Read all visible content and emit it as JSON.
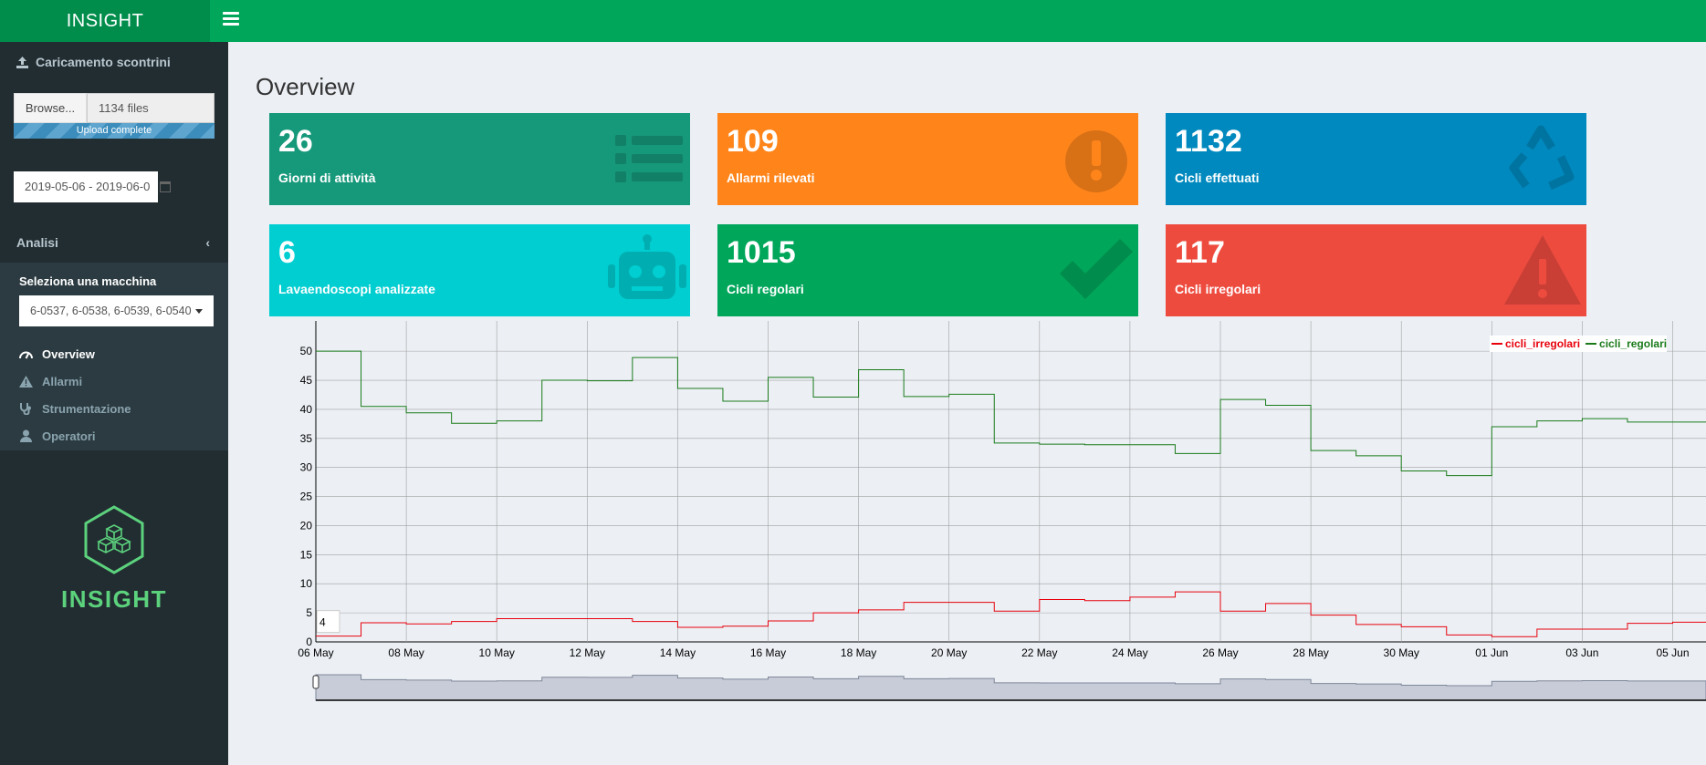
{
  "header": {
    "app_title": "INSIGHT",
    "menu_icon": "bars-icon"
  },
  "sidebar": {
    "upload_title": "Caricamento scontrini",
    "browse_label": "Browse...",
    "file_value": "1134 files",
    "progress_text": "Upload complete",
    "progress": 1.0,
    "date_range": "2019-05-06 - 2019-06-0",
    "section_label": "Analisi",
    "machine_label": "Seleziona una macchina",
    "machine_value": "6-0537, 6-0538, 6-0539, 6-0540",
    "nav": [
      {
        "label": "Overview",
        "icon": "tachometer-icon",
        "active": true
      },
      {
        "label": "Allarmi",
        "icon": "warning-icon",
        "active": false
      },
      {
        "label": "Strumentazione",
        "icon": "stethoscope-icon",
        "active": false
      },
      {
        "label": "Operatori",
        "icon": "user-icon",
        "active": false
      }
    ],
    "brand_name": "INSIGHT"
  },
  "main": {
    "title": "Overview",
    "boxes": [
      {
        "value": "26",
        "label": "Giorni di attività",
        "color": "#16987a",
        "icon": "list-icon"
      },
      {
        "value": "109",
        "label": "Allarmi rilevati",
        "color": "#ff851b",
        "icon": "exclamation-circle-icon"
      },
      {
        "value": "1132",
        "label": "Cicli effettuati",
        "color": "#0089be",
        "icon": "recycle-icon"
      },
      {
        "value": "6",
        "label": "Lavaendoscopi analizzate",
        "color": "#00ced1",
        "icon": "robot-icon"
      },
      {
        "value": "1015",
        "label": "Cicli regolari",
        "color": "#00a65a",
        "icon": "check-icon"
      },
      {
        "value": "117",
        "label": "Cicli irregolari",
        "color": "#ee4b3f",
        "icon": "warning-icon"
      }
    ]
  },
  "chart_data": {
    "type": "line",
    "step": true,
    "x_tick_labels": [
      "06 May",
      "08 May",
      "10 May",
      "12 May",
      "14 May",
      "16 May",
      "18 May",
      "20 May",
      "22 May",
      "24 May",
      "26 May",
      "28 May",
      "30 May",
      "01 Jun",
      "03 Jun",
      "05 Jun"
    ],
    "x": [
      "2019-05-06",
      "2019-05-07",
      "2019-05-08",
      "2019-05-09",
      "2019-05-10",
      "2019-05-11",
      "2019-05-12",
      "2019-05-13",
      "2019-05-14",
      "2019-05-15",
      "2019-05-16",
      "2019-05-17",
      "2019-05-18",
      "2019-05-19",
      "2019-05-20",
      "2019-05-21",
      "2019-05-22",
      "2019-05-23",
      "2019-05-24",
      "2019-05-25",
      "2019-05-26",
      "2019-05-27",
      "2019-05-28",
      "2019-05-29",
      "2019-05-30",
      "2019-05-31",
      "2019-06-01",
      "2019-06-02",
      "2019-06-03",
      "2019-06-04",
      "2019-06-05",
      "2019-06-06"
    ],
    "ylim": [
      0,
      53
    ],
    "yticks": [
      0,
      5,
      10,
      15,
      20,
      25,
      30,
      35,
      40,
      45,
      50
    ],
    "grid": true,
    "legend_position": "top-right",
    "value_label": "4",
    "series": [
      {
        "name": "cicli_irregolari",
        "color": "#e8000b",
        "values": [
          1,
          3.3,
          3.1,
          3.5,
          4,
          4,
          4,
          3.5,
          2.5,
          2.7,
          3.6,
          5,
          5.5,
          6.8,
          6.8,
          5.3,
          7.3,
          7.1,
          7.7,
          8.6,
          5.3,
          6.6,
          4.6,
          3,
          2.6,
          1.2,
          0.9,
          2.2,
          2.2,
          3.2,
          3.4,
          3.5
        ]
      },
      {
        "name": "cicli_regolari",
        "color": "#1a7a1a",
        "values": [
          50,
          40.5,
          39.4,
          37.6,
          38,
          45,
          44.9,
          48.9,
          43.6,
          41.4,
          45.5,
          42.1,
          46.8,
          42.2,
          42.6,
          34.2,
          34,
          33.9,
          33.9,
          32.4,
          41.7,
          40.7,
          32.9,
          32,
          29.4,
          28.6,
          37,
          38,
          38.4,
          37.8,
          37.8,
          38
        ]
      }
    ]
  }
}
